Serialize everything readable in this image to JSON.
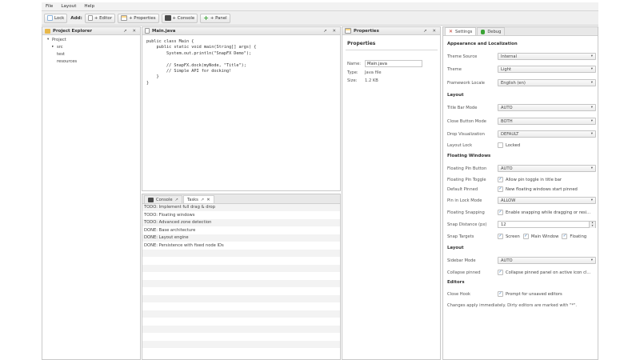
{
  "menubar": {
    "items": [
      "File",
      "Layout",
      "Help"
    ]
  },
  "toolbar": {
    "lock_label": "Lock",
    "add_label": "Add:",
    "buttons": [
      "+ Editor",
      "+ Properties",
      "+ Console",
      "+ Panel"
    ]
  },
  "project_explorer": {
    "title": "Project Explorer",
    "float_icon": "↗",
    "close_icon": "✕",
    "tree": [
      {
        "arrow": "▾",
        "label": "Project"
      },
      {
        "arrow": "▸",
        "label": "src"
      },
      {
        "arrow": "",
        "label": "test"
      },
      {
        "arrow": "",
        "label": "resources"
      }
    ]
  },
  "editor": {
    "title": "Main.java",
    "float_icon": "↗",
    "close_icon": "✕",
    "code": "public class Main {\n    public static void main(String[] args) {\n        System.out.println(\"SnapFX Demo\");\n\n        // SnapFX.dock(myNode, \"Title\");\n        // Simple API for docking!\n    }\n}"
  },
  "bottom": {
    "tabs": [
      {
        "label": "Console",
        "icon": "↗"
      },
      {
        "label": "Tasks",
        "icon": "↗",
        "close": "✕"
      }
    ],
    "tasks": [
      "TODO: Implement full drag & drop",
      "TODO: Floating windows",
      "TODO: Advanced zone detection",
      "DONE: Base architecture",
      "DONE: Layout engine",
      "DONE: Persistence with fixed node IDs"
    ]
  },
  "properties": {
    "title": "Properties",
    "float_icon": "↗",
    "close_icon": "✕",
    "heading": "Properties",
    "name_label": "Name:",
    "name_value": "Main.java",
    "type_label": "Type:",
    "type_value": "Java file",
    "size_label": "Size:",
    "size_value": "1.2 KB"
  },
  "settings": {
    "tab_settings": "Settings",
    "tab_debug": "Debug",
    "section_appearance": "Appearance and Localization",
    "theme_source_label": "Theme Source",
    "theme_source_value": "Internal",
    "theme_label": "Theme",
    "theme_value": "Light",
    "framework_locale_label": "Framework Locale",
    "framework_locale_value": "English (en)",
    "section_layout": "Layout",
    "title_bar_mode_label": "Title Bar Mode",
    "title_bar_mode_value": "AUTO",
    "close_button_mode_label": "Close Button Mode",
    "close_button_mode_value": "BOTH",
    "drop_visualization_label": "Drop Visualization",
    "drop_visualization_value": "DEFAULT",
    "layout_lock_label": "Layout Lock",
    "layout_lock_check": "Locked",
    "section_floating": "Floating Windows",
    "floating_pin_button_label": "Floating Pin Button",
    "floating_pin_button_value": "AUTO",
    "floating_pin_toggle_label": "Floating Pin Toggle",
    "floating_pin_toggle_check": "Allow pin toggle in title bar",
    "default_pinned_label": "Default Pinned",
    "default_pinned_check": "New floating windows start pinned",
    "pin_lock_mode_label": "Pin in Lock Mode",
    "pin_lock_mode_value": "ALLOW",
    "floating_snapping_label": "Floating Snapping",
    "floating_snapping_check": "Enable snapping while dragging or resi...",
    "snap_distance_label": "Snap Distance (px)",
    "snap_distance_value": "12",
    "snap_targets_label": "Snap Targets",
    "snap_target_screen": "Screen",
    "snap_target_main": "Main Window",
    "snap_target_floating": "Floating",
    "section_layout2": "Layout",
    "sidebar_mode_label": "Sidebar Mode",
    "sidebar_mode_value": "AUTO",
    "collapse_pinned_label": "Collapse pinned",
    "collapse_pinned_check": "Collapse pinned panel on active icon cl...",
    "section_editors": "Editors",
    "close_hook_label": "Close Hook",
    "close_hook_check": "Prompt for unsaved editors",
    "footer_note": "Changes apply immediately. Dirty editors are marked with \"*\"."
  },
  "colors": {
    "folder_icon": "#e8b84a",
    "accent_check": "#2a6db5",
    "console_icon": "#4a4a4a",
    "add_green": "#3aa335"
  }
}
